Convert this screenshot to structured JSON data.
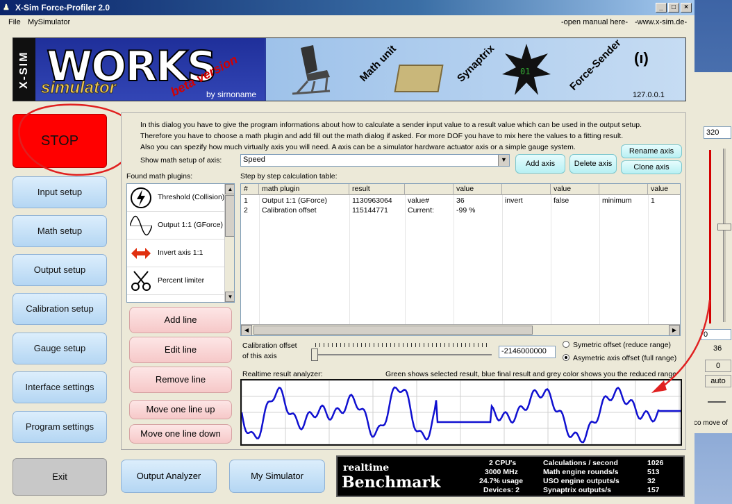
{
  "window": {
    "title": "X-Sim Force-Profiler 2.0"
  },
  "menu": {
    "file": "File",
    "mysim": "MySimulator",
    "manual": "-open manual here-",
    "web": "-www.x-sim.de-"
  },
  "banner": {
    "xsim": "X-SIM",
    "works": "WORKS",
    "simulator": "simulator",
    "beta": "beta version",
    "by": "by sirnoname",
    "mathunit": "Math unit",
    "synaptrix": "Synaptrix",
    "forcesender": "Force-Sender",
    "antenna": "(ı)",
    "ip": "127.0.0.1"
  },
  "sidebar": {
    "stop": "STOP",
    "items": [
      "Input setup",
      "Math setup",
      "Output setup",
      "Calibration setup",
      "Gauge setup",
      "Interface settings",
      "Program settings"
    ],
    "exit": "Exit"
  },
  "intro": {
    "line1": "In this dialog you have to give the program informations about how to calculate a sender input value to a result value which can be used in the output setup.",
    "line2": "Therefore you have to choose a math plugin and add fill out the math dialog if asked. For more DOF you have to mix here the values to a fitting result.",
    "line3": "Also you can spezify how much virtually axis you will need. A axis can be a simulator hardware actuator axis or a simple gauge system."
  },
  "axis": {
    "label": "Show math setup of axis:",
    "selected": "Speed"
  },
  "axisbuttons": {
    "add": "Add axis",
    "delete": "Delete axis",
    "rename": "Rename axis",
    "clone": "Clone axis"
  },
  "plugins": {
    "label": "Found math plugins:",
    "items": [
      {
        "name": "Threshold (Collision)",
        "icon": "lightning-icon"
      },
      {
        "name": "Output 1:1 (GForce)",
        "icon": "sine-wave-icon"
      },
      {
        "name": "Invert axis 1:1",
        "icon": "invert-arrows-icon"
      },
      {
        "name": "Percent limiter",
        "icon": "scissors-icon"
      }
    ]
  },
  "linebuttons": {
    "add": "Add line",
    "edit": "Edit line",
    "remove": "Remove line",
    "up": "Move one line up",
    "down": "Move one line down"
  },
  "table": {
    "label": "Step by step calculation table:",
    "headers": [
      "#",
      "math plugin",
      "result",
      "",
      "value",
      "",
      "value",
      "",
      "value"
    ],
    "rows": [
      [
        "1",
        "Output 1:1 (GForce)",
        "1130963064",
        "value#",
        "36",
        "invert",
        "false",
        "minimum",
        "1"
      ],
      [
        "2",
        "Calibration offset",
        "115144771",
        "Current:",
        "-99 %",
        "",
        "",
        "",
        ""
      ]
    ]
  },
  "calibration": {
    "label1": "Calibration offset",
    "label2": "of this axis",
    "value": "-2146000000",
    "slider_fraction": 0.0,
    "radio1": "Symetric offset (reduce range)",
    "radio2": "Asymetric axis offset (full range)",
    "selected_radio": 2
  },
  "analyzer": {
    "label": "Realtime result analyzer:",
    "legend": "Green shows selected result, blue final result and grey color shows you the reduced range",
    "colors": {
      "line": "#1010d0",
      "grid": "#d0d0d0"
    }
  },
  "bottom": {
    "output_analyzer": "Output Analyzer",
    "my_simulator": "My Simulator"
  },
  "benchmark": {
    "realtime": "realtime",
    "title": "Benchmark",
    "cpus": "2 CPU's",
    "mhz": "3000 MHz",
    "usage": "24.7% usage",
    "devices": "Devices: 2",
    "calc_label": "Calculations / second",
    "calc_val": "1026",
    "math_label": "Math engine rounds/s",
    "math_val": "513",
    "uso_label": "USO engine outputs/s",
    "uso_val": "32",
    "syn_label": "Synaptrix outputs/s",
    "syn_val": "157"
  },
  "bgwindow": {
    "field": "320",
    "field2": "0",
    "num": "36",
    "b0": "0",
    "auto": "auto",
    "move": "co move of"
  }
}
